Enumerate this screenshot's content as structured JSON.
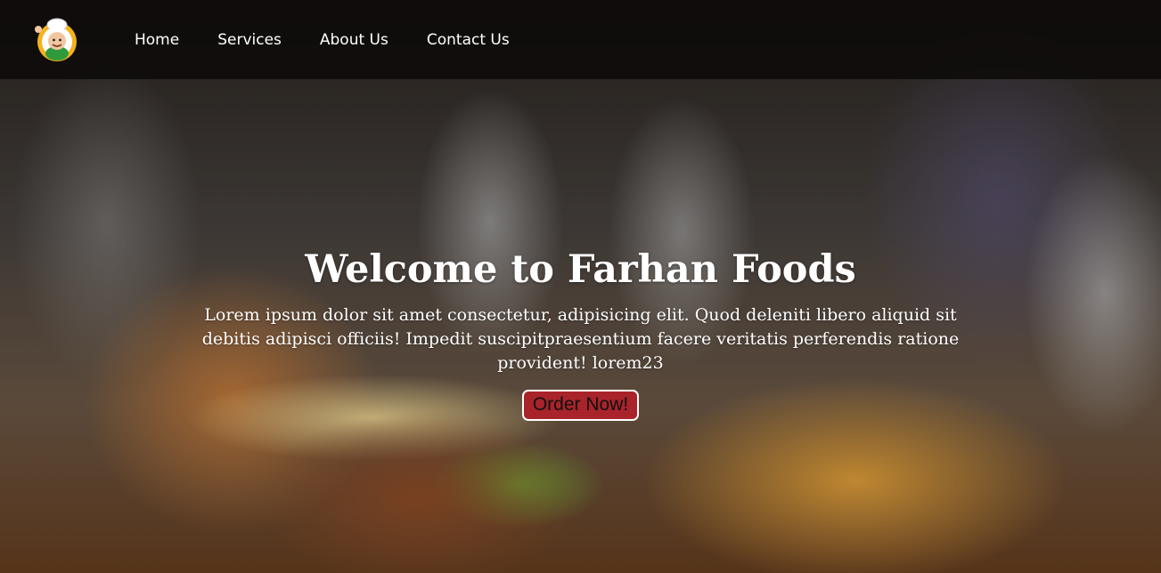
{
  "logo": {
    "icon": "chef-mascot-icon",
    "colors": {
      "ring": "#f4b21c",
      "apron": "#2e9a3c",
      "hat": "#ffffff"
    }
  },
  "nav": {
    "items": [
      {
        "label": "Home"
      },
      {
        "label": "Services"
      },
      {
        "label": "About Us"
      },
      {
        "label": "Contact Us"
      }
    ]
  },
  "hero": {
    "background": "burger-and-fries-photo",
    "title": "Welcome to Farhan Foods",
    "text": "Lorem ipsum dolor sit amet consectetur, adipisicing elit. Quod deleniti libero aliquid sit debitis adipisci officiis! Impedit suscipitpraesentium facere veritatis perferendis ratione provident! lorem23",
    "button_label": "Order Now!",
    "colors": {
      "button": "#a8232a",
      "button_border": "#ffffff",
      "text": "#ffffff"
    }
  }
}
